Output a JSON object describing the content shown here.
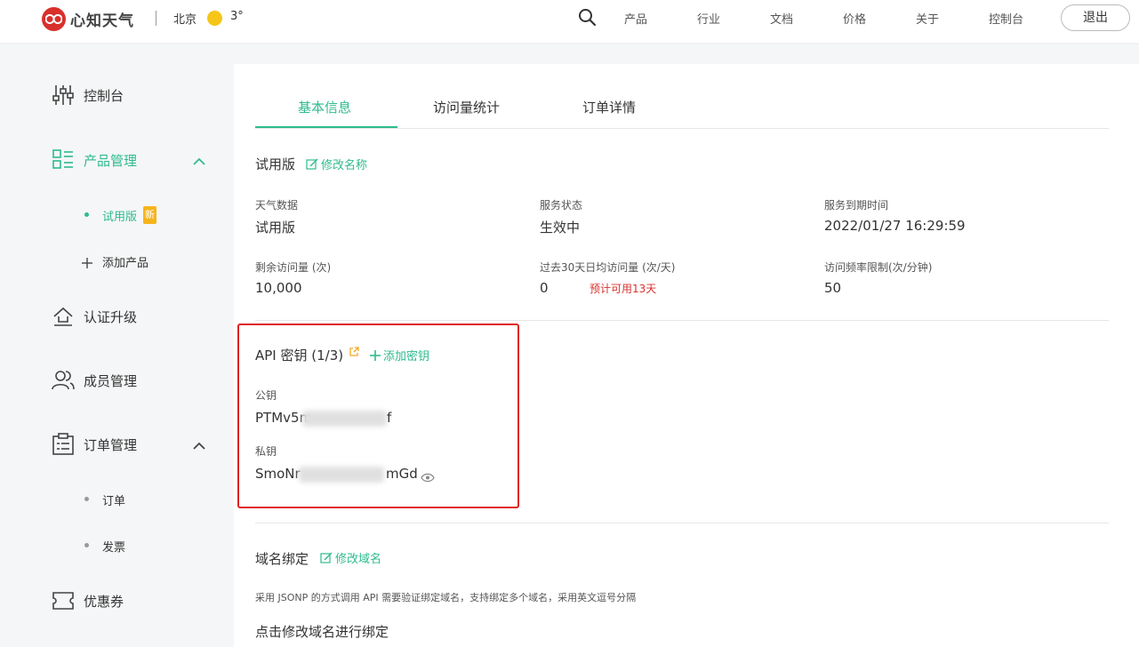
{
  "header": {
    "logo_text": "心知天气",
    "city": "北京",
    "temperature": "3°",
    "nav": [
      "产品",
      "行业",
      "文档",
      "价格",
      "关于",
      "控制台"
    ],
    "logout_label": "退出"
  },
  "sidebar": {
    "console": "控制台",
    "product_mgmt": "产品管理",
    "trial": "试用版",
    "new_badge": "新",
    "add_product": "添加产品",
    "cert_upgrade": "认证升级",
    "member_mgmt": "成员管理",
    "order_mgmt": "订单管理",
    "orders": "订单",
    "invoice": "发票",
    "coupons": "优惠券"
  },
  "tabs": [
    "基本信息",
    "访问量统计",
    "订单详情"
  ],
  "basic": {
    "title": "试用版",
    "rename_link": "修改名称",
    "fields": [
      {
        "label": "天气数据",
        "value": "试用版"
      },
      {
        "label": "服务状态",
        "value": "生效中"
      },
      {
        "label": "服务到期时间",
        "value": "2022/01/27 16:29:59"
      },
      {
        "label": "剩余访问量 (次)",
        "value": "10,000"
      },
      {
        "label": "过去30天日均访问量 (次/天)",
        "value": "0"
      },
      {
        "label": "访问频率限制(次/分钟)",
        "value": "50"
      }
    ],
    "estimate_note": "预计可用13天"
  },
  "api": {
    "title": "API 密钥 (1/3)",
    "add_link": "添加密钥",
    "public_key_label": "公钥",
    "public_key_value": "PTMv5m",
    "public_key_tail": "f",
    "private_key_label": "私钥",
    "private_key_value": "SmoNr",
    "private_key_tail": "mGd"
  },
  "domain": {
    "title": "域名绑定",
    "edit_link": "修改域名",
    "description": "采用 JSONP 的方式调用 API 需要验证绑定域名，支持绑定多个域名，采用英文逗号分隔",
    "cta": "点击修改域名进行绑定"
  },
  "colors": {
    "accent": "#2ebb8e",
    "brand": "#d9302c",
    "warning": "#d9302c",
    "highlight_box": "#e02020"
  }
}
